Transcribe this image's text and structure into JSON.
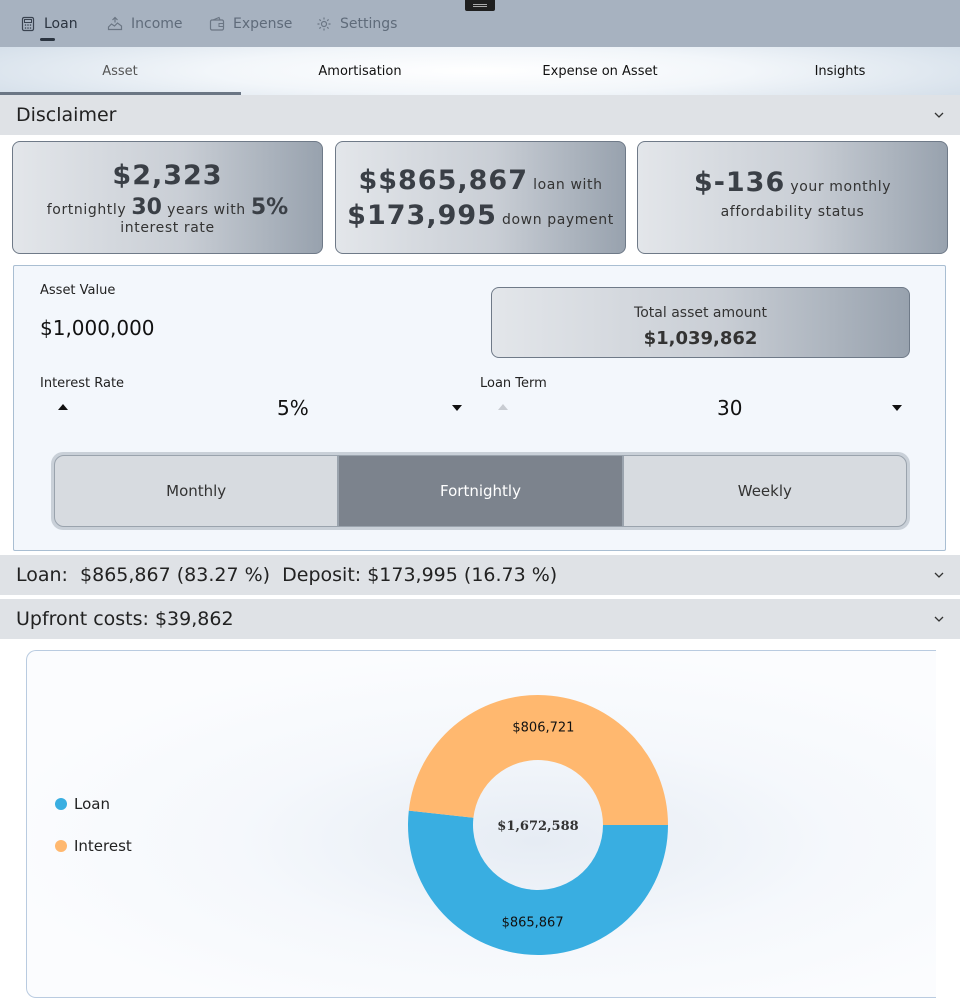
{
  "nav": {
    "items": [
      {
        "label": "Loan",
        "icon": "calculator-icon"
      },
      {
        "label": "Income",
        "icon": "income-icon"
      },
      {
        "label": "Expense",
        "icon": "wallet-icon"
      },
      {
        "label": "Settings",
        "icon": "gear-icon"
      }
    ],
    "active": "Loan"
  },
  "subtabs": {
    "items": [
      "Asset",
      "Amortisation",
      "Expense on Asset",
      "Insights"
    ],
    "active": "Asset"
  },
  "disclaimer": {
    "title": "Disclaimer"
  },
  "cards": {
    "payment": {
      "currency": "$",
      "amount": "2,323",
      "frequency": "fortnightly",
      "years": "30",
      "years_text": "years with",
      "rate": "5%",
      "rate_text": "interest rate"
    },
    "loan": {
      "currency": "$",
      "loan_amount": "$865,867",
      "loan_text": "loan with",
      "down_payment": "$173,995",
      "down_text": "down payment"
    },
    "affordability": {
      "currency": "$",
      "amount": "-136",
      "text": "your monthly affordability status"
    }
  },
  "form": {
    "asset_value_label": "Asset Value",
    "asset_value": "$1,000,000",
    "total_label": "Total asset amount",
    "total_value": "$1,039,862",
    "interest_rate_label": "Interest Rate",
    "interest_rate_value": "5%",
    "loan_term_label": "Loan Term",
    "loan_term_value": "30",
    "frequency_options": [
      "Monthly",
      "Fortnightly",
      "Weekly"
    ],
    "frequency_selected": "Fortnightly"
  },
  "loan_summary": {
    "title": "Loan:  $865,867 (83.27 %)  Deposit: $173,995 (16.73 %)"
  },
  "upfront": {
    "title": "Upfront costs: $39,862"
  },
  "colors": {
    "loan": "#39aee1",
    "interest": "#ffb86f"
  },
  "chart_data": {
    "type": "pie",
    "series": [
      {
        "name": "Loan",
        "value": 865867,
        "label": "$865,867"
      },
      {
        "name": "Interest",
        "value": 806721,
        "label": "$806,721"
      }
    ],
    "total_label": "$1,672,588",
    "legend": [
      "Loan",
      "Interest"
    ],
    "legend_position": "left"
  }
}
